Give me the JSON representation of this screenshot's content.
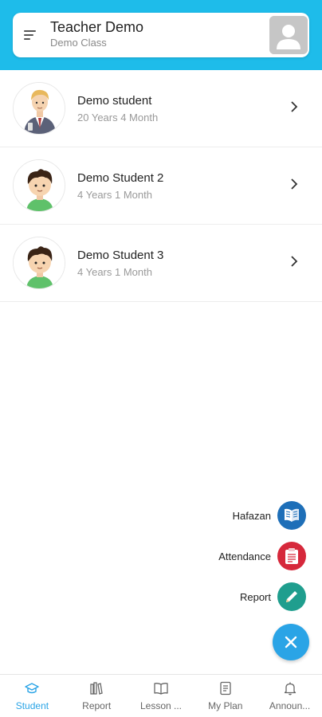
{
  "header": {
    "title": "Teacher Demo",
    "subtitle": "Demo Class"
  },
  "students": [
    {
      "name": "Demo student",
      "age": "20 Years 4 Month",
      "avatar": "adult-student-avatar"
    },
    {
      "name": "Demo Student 2",
      "age": "4 Years 1 Month",
      "avatar": "child-avatar"
    },
    {
      "name": "Demo Student 3",
      "age": "4 Years 1 Month",
      "avatar": "child-avatar"
    }
  ],
  "fab_menu": {
    "items": [
      {
        "label": "Hafazan",
        "icon": "quran-book-icon",
        "color": "#1e6fb8"
      },
      {
        "label": "Attendance",
        "icon": "clipboard-icon",
        "color": "#d6283b"
      },
      {
        "label": "Report",
        "icon": "pencil-icon",
        "color": "#1f9e8e"
      }
    ],
    "main_icon": "close-icon",
    "main_color": "#2aa4e6"
  },
  "bottom_nav": [
    {
      "label": "Student",
      "icon": "graduation-cap-icon",
      "active": true
    },
    {
      "label": "Report",
      "icon": "books-icon",
      "active": false
    },
    {
      "label": "Lesson ...",
      "icon": "open-book-icon",
      "active": false
    },
    {
      "label": "My Plan",
      "icon": "document-icon",
      "active": false
    },
    {
      "label": "Announ...",
      "icon": "bell-icon",
      "active": false
    }
  ],
  "colors": {
    "header_bg": "#1ebcea",
    "accent": "#2aa4e6"
  }
}
